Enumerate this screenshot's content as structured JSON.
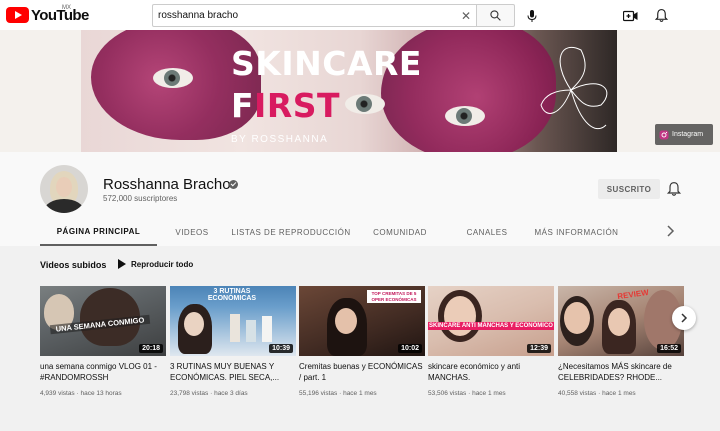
{
  "header": {
    "logo_text": "YouTube",
    "region": "MX",
    "search_value": "rosshanna bracho",
    "icons": [
      "search-icon",
      "mic-icon",
      "create-video-icon",
      "notifications-icon"
    ]
  },
  "banner": {
    "title_line1": "SKINCARE",
    "title_f": "F",
    "title_rest": "IRST",
    "byline": "BY ROSSHANNA",
    "link_label": "Instagram"
  },
  "channel": {
    "name": "Rosshanna Bracho",
    "subscribers": "572,000 suscriptores",
    "subscribe_label": "SUSCRITO"
  },
  "tabs": [
    {
      "label": "PÁGINA PRINCIPAL",
      "active": true
    },
    {
      "label": "VIDEOS"
    },
    {
      "label": "LISTAS DE REPRODUCCIÓN"
    },
    {
      "label": "COMUNIDAD"
    },
    {
      "label": "CANALES"
    },
    {
      "label": "MÁS INFORMACIÓN"
    }
  ],
  "section": {
    "title": "Videos subidos",
    "play_all": "Reproducir todo"
  },
  "videos": [
    {
      "title": "una semana conmigo VLOG 01 - #RANDOMROSSH",
      "meta": "4,939 vistas · hace 13 horas",
      "duration": "20:18",
      "thumb_text": "UNA SEMANA CONMIGO"
    },
    {
      "title": "3 RUTINAS MUY BUENAS Y ECONÓMICAS. PIEL SECA,...",
      "meta": "23,798 vistas · hace 3 días",
      "duration": "10:39",
      "thumb_text": "3 RUTINAS ECONÓMICAS"
    },
    {
      "title": "Cremitas buenas y ECONÓMICAS / part. 1",
      "meta": "55,196 vistas · hace 1 mes",
      "duration": "10:02",
      "thumb_text": "TOP CREMITAS DE 5 OPER ECONÓMICAS"
    },
    {
      "title": "skincare económico y anti MANCHAS.",
      "meta": "53,506 vistas · hace 1 mes",
      "duration": "12:39",
      "thumb_text": "SKINCARE ANTI MANCHAS Y ECONÓMICO"
    },
    {
      "title": "¿Necesitamos MÁS skincare de CELEBRIDADES? RHODE...",
      "meta": "40,558 vistas · hace 1 mes",
      "duration": "16:52",
      "thumb_text": "REVIEW"
    }
  ]
}
